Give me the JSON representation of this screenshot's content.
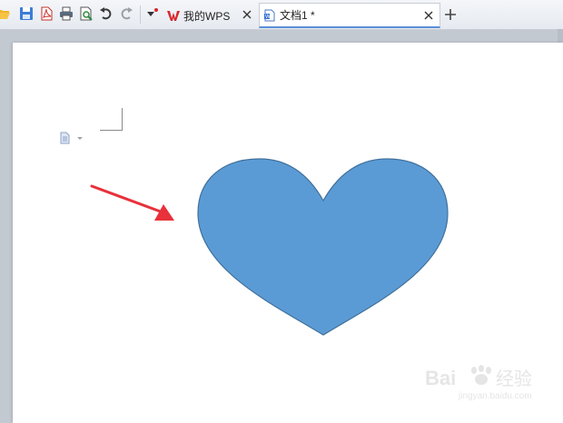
{
  "toolbar": {
    "buttons": [
      {
        "name": "open-folder-icon"
      },
      {
        "name": "save-icon"
      },
      {
        "name": "export-pdf-icon"
      },
      {
        "name": "print-icon"
      },
      {
        "name": "print-preview-icon"
      },
      {
        "name": "undo-icon"
      },
      {
        "name": "redo-icon"
      },
      {
        "name": "customize-toolbar-icon"
      }
    ]
  },
  "tabs": [
    {
      "label": "我的WPS",
      "icon": "wps-logo-icon",
      "active": false
    },
    {
      "label": "文档1 *",
      "icon": "document-icon",
      "active": true
    }
  ],
  "new_tab_symbol": "+",
  "watermark": {
    "url": "jingyan.baidu.com"
  },
  "colors": {
    "heart_fill": "#5b9bd5",
    "heart_stroke": "#41719c",
    "arrow": "#e8313a",
    "wps_red": "#d9262b",
    "active_tab_underline": "#5b8fd6"
  }
}
